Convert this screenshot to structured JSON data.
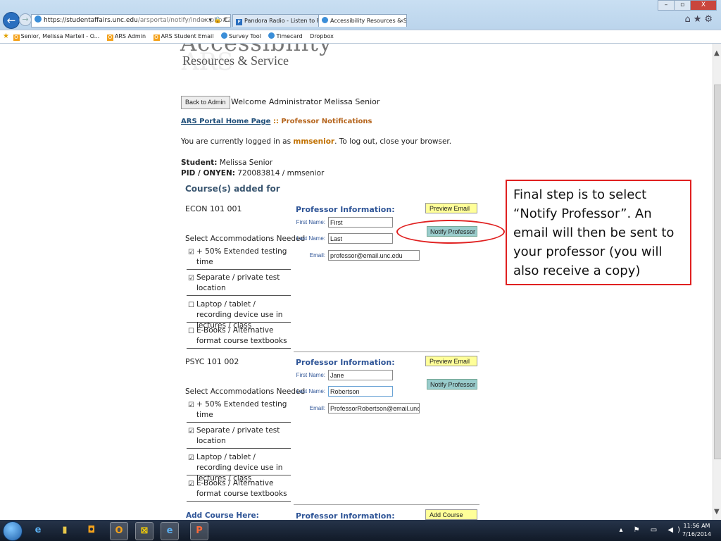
{
  "browser": {
    "url_prefix": "https://",
    "url_host": "studentaffairs.unc.edu",
    "url_path": "/arsportal/notify/index.php#2",
    "addr_controls": "⌕ ▾ 🔒 C",
    "tabs": [
      {
        "label": "Pandora Radio - Listen to Free ...",
        "fav": "P"
      },
      {
        "label": "Accessibility Resources & S...",
        "close": "×"
      }
    ],
    "window_controls": {
      "min": "–",
      "max": "▫",
      "close": "X"
    },
    "toolbar_icons": "⌂★⚙",
    "favorites": [
      "Senior, Melissa Martell - O...",
      "ARS Admin",
      "ARS Student Email",
      "Survey Tool",
      "Timecard",
      "Dropbox"
    ]
  },
  "page": {
    "logo_line1": "Accessibility",
    "logo_watermark": "ARS",
    "logo_line2": "Resources & Service",
    "back_button": "Back to Admin",
    "welcome": "Welcome Administrator Melissa Senior",
    "breadcrumb_link": "ARS Portal Home Page",
    "breadcrumb_sep": " :: ",
    "breadcrumb_current": "Professor Notifications",
    "login_pre": "You are currently logged in as ",
    "login_user": "mmsenior",
    "login_post": ". To log out, close your browser.",
    "student_label": "Student:",
    "student_name": " Melissa Senior",
    "pid_label": "PID / ONYEN:",
    "pid_value": " 720083814 / mmsenior",
    "courses_title": "Course(s) added for",
    "prof_info_label": "Professor Information:",
    "first_name_label": "First Name:",
    "last_name_label": "Last Name:",
    "email_label": "Email:",
    "select_acc_label": "Select Accommodations Needed",
    "preview_btn": "Preview Email",
    "notify_btn": "Notify Professor",
    "add_course_label": "Add Course Here:",
    "add_course_btn": "Add Course",
    "courses": [
      {
        "name": "ECON 101 001",
        "first": "First",
        "last": "Last",
        "email": "professor@email.unc.edu",
        "acc": [
          {
            "label": "+ 50% Extended testing time",
            "checked": "☑"
          },
          {
            "label": "Separate / private test location",
            "checked": "☑"
          },
          {
            "label": "Laptop / tablet / recording device use in lectures / class",
            "checked": "☐"
          },
          {
            "label": "E-Books / Alternative format course textbooks",
            "checked": "☐"
          }
        ]
      },
      {
        "name": "PSYC 101 002",
        "first": "Jane",
        "last": "Robertson",
        "email": "ProfessorRobertson@email.unc.e",
        "acc": [
          {
            "label": "+ 50% Extended testing time",
            "checked": "☑"
          },
          {
            "label": "Separate / private test location",
            "checked": "☑"
          },
          {
            "label": "Laptop / tablet / recording device use in lectures / class",
            "checked": "☑"
          },
          {
            "label": "E-Books / Alternative format course textbooks",
            "checked": "☑"
          }
        ]
      }
    ]
  },
  "callout": {
    "text": "Final step is to select “Notify Professor”. An email will then be sent to your professor (you will also receive a copy)",
    "color": "#e02020"
  },
  "taskbar": {
    "icons": [
      "e",
      "▮",
      "◘",
      "O",
      "⊠",
      "e",
      "P"
    ],
    "tray": "▴ ⚑ ▭ ◀)",
    "time": "11:56 AM",
    "date": "7/16/2014"
  }
}
